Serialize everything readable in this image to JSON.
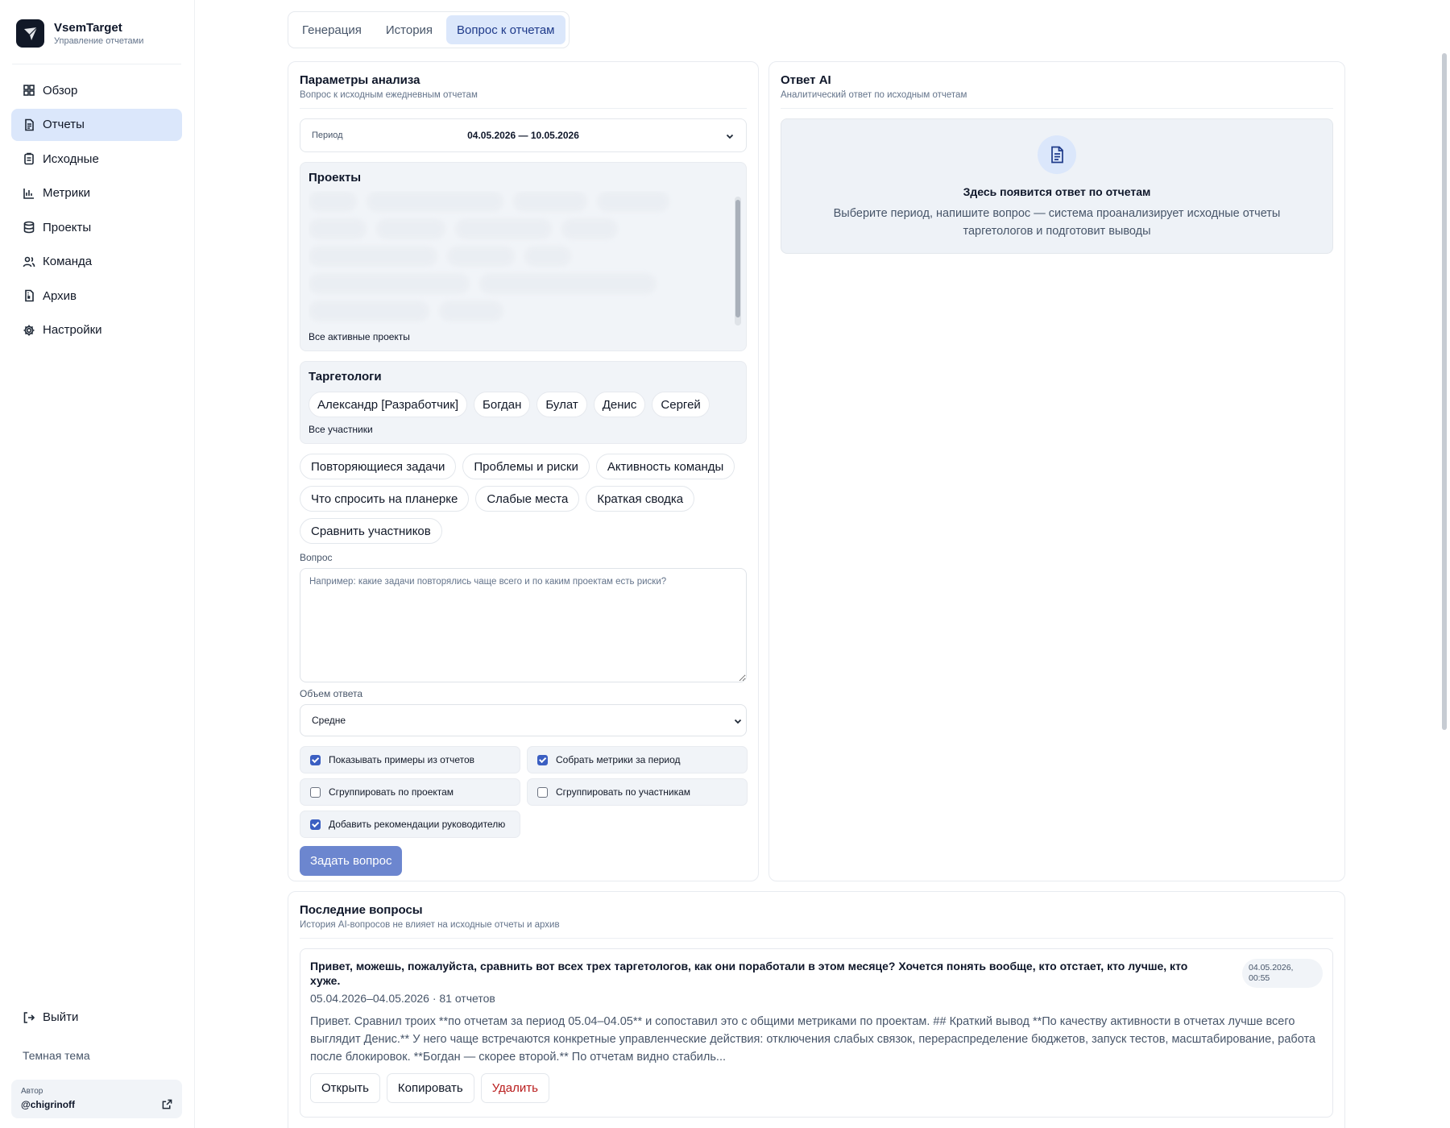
{
  "brand": {
    "name": "VsemTarget",
    "subtitle": "Управление отчетами"
  },
  "sidebar": {
    "items": [
      {
        "label": "Обзор",
        "icon": "grid-icon"
      },
      {
        "label": "Отчеты",
        "icon": "document-icon",
        "active": true
      },
      {
        "label": "Исходные",
        "icon": "clipboard-icon"
      },
      {
        "label": "Метрики",
        "icon": "bar-chart-icon"
      },
      {
        "label": "Проекты",
        "icon": "database-icon"
      },
      {
        "label": "Команда",
        "icon": "users-icon"
      },
      {
        "label": "Архив",
        "icon": "archive-file-icon"
      },
      {
        "label": "Настройки",
        "icon": "gear-icon"
      }
    ],
    "logout": "Выйти",
    "theme": "Темная тема",
    "author_label": "Автор",
    "author_name": "@chigrinoff"
  },
  "tabs": [
    {
      "label": "Генерация"
    },
    {
      "label": "История"
    },
    {
      "label": "Вопрос к отчетам",
      "active": true
    }
  ],
  "params": {
    "title": "Параметры  анализа",
    "subtitle": "Вопрос к исходным ежедневным отчетам",
    "period_label": "Период",
    "period_value": "04.05.2026 — 10.05.2026",
    "projects_title": "Проекты",
    "projects_foot": "Все активные проекты",
    "targeters_title": "Таргетологи",
    "targeters": [
      "Александр [Разработчик]",
      "Богдан",
      "Булат",
      "Денис",
      "Сергей"
    ],
    "targeters_foot": "Все участники",
    "presets": [
      "Повторяющиеся задачи",
      "Проблемы и риски",
      "Активность команды",
      "Что спросить на планерке",
      "Слабые места",
      "Краткая сводка",
      "Сравнить участников"
    ],
    "question_label": "Вопрос",
    "question_placeholder": "Например: какие задачи повторялись чаще всего и по каким проектам есть риски?",
    "volume_label": "Объем ответа",
    "volume_value": "Средне",
    "checks": [
      {
        "label": "Показывать примеры из отчетов",
        "checked": true
      },
      {
        "label": "Собрать метрики за период",
        "checked": true
      },
      {
        "label": "Сгруппировать по проектам",
        "checked": false
      },
      {
        "label": "Сгруппировать по участникам",
        "checked": false
      },
      {
        "label": "Добавить рекомендации руководителю",
        "checked": true
      }
    ],
    "submit": "Задать вопрос"
  },
  "answer": {
    "title": "Ответ  AI",
    "subtitle": "Аналитический ответ по исходным отчетам",
    "empty_title": "Здесь появится ответ по отчетам",
    "empty_text": "Выберите период, напишите вопрос — система проанализирует исходные отчеты таргетологов и подготовит выводы"
  },
  "recent": {
    "title": "Последние  вопросы",
    "subtitle": "История AI-вопросов не влияет на исходные отчеты и архив",
    "items": [
      {
        "question": "Привет, можешь, пожалуйста, сравнить вот всех трех таргетологов, как они поработали в этом месяце? Хочется понять вообще, кто отстает, кто лучше, кто хуже.",
        "meta": "05.04.2026–04.05.2026 · 81 отчетов",
        "date": "04.05.2026, 00:55",
        "answer": "Привет. Сравнил троих **по отчетам за период 05.04–04.05** и сопоставил это с общими метриками по проектам. ## Краткий вывод **По качеству активности в отчетах лучше всего выглядит Денис.** У него чаще встречаются конкретные управленческие действия: отключения слабых связок, перераспределение бюджетов, запуск тестов, масштабирование, работа после блокировок. **Богдан — скорее второй.** По отчетам видно стабиль...",
        "actions": {
          "open": "Открыть",
          "copy": "Копировать",
          "delete": "Удалить"
        }
      }
    ]
  }
}
